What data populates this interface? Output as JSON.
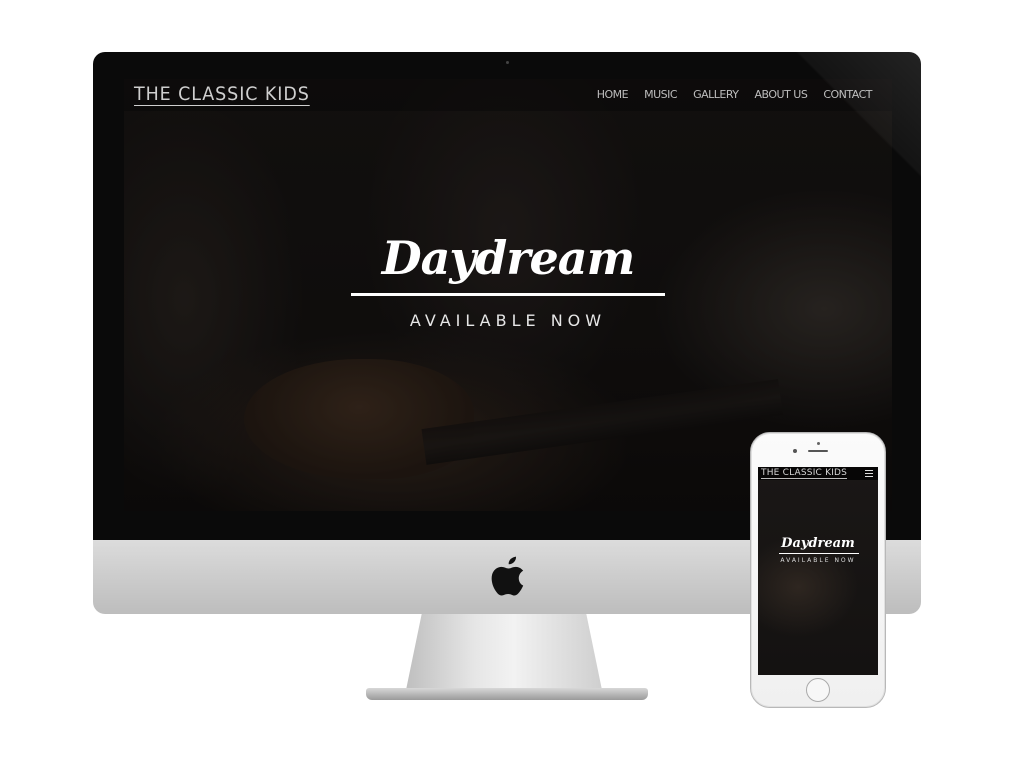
{
  "site": {
    "logo": "THE CLASSIC KIDS",
    "nav": [
      "HOME",
      "MUSIC",
      "GALLERY",
      "ABOUT US",
      "CONTACT"
    ],
    "hero": {
      "title": "Daydream",
      "subtitle": "AVAILABLE NOW"
    }
  },
  "devices": {
    "desktop": "iMac",
    "mobile": "iPhone"
  },
  "icons": {
    "brand": "apple-logo-icon",
    "mobile_menu": "hamburger-menu-icon"
  },
  "colors": {
    "hero_text": "#ffffff",
    "nav_text": "#bdbdbd",
    "site_background": "#171413"
  }
}
